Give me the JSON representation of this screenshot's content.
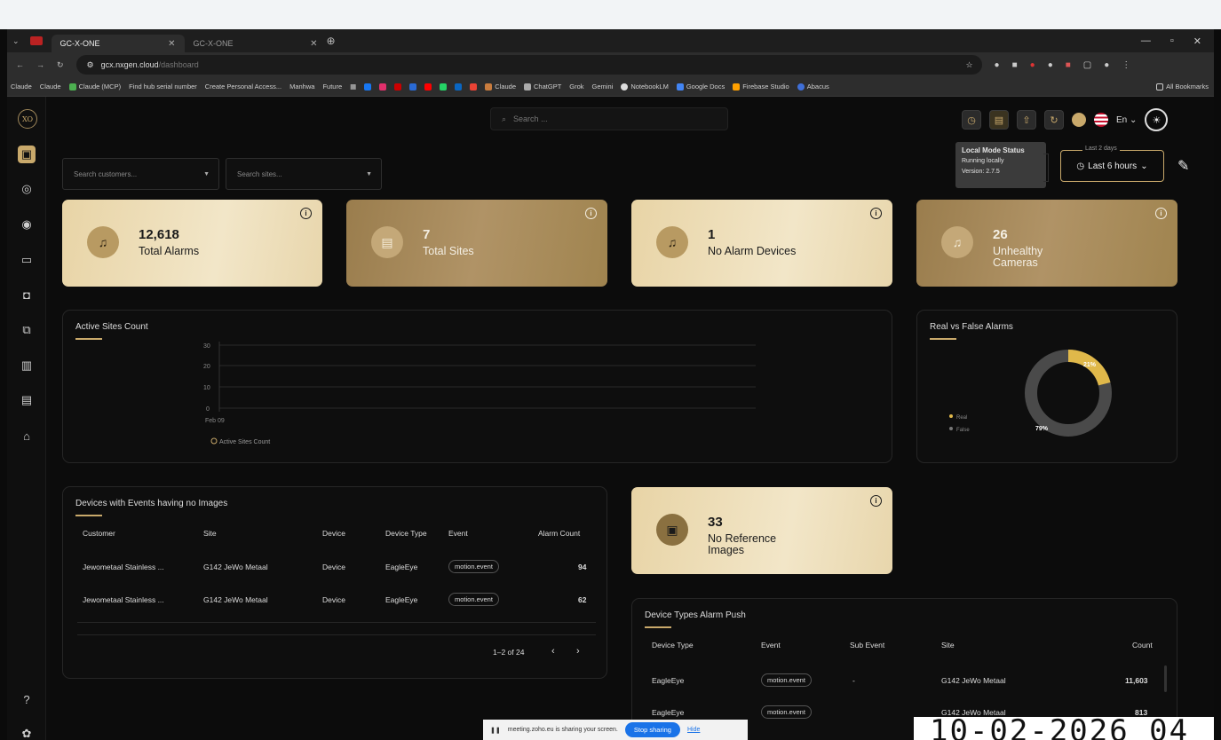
{
  "browser": {
    "tabs": [
      {
        "title": "GC-X-ONE",
        "active": true
      },
      {
        "title": "GC-X-ONE",
        "active": false
      }
    ],
    "url_host": "gcx.nxgen.cloud",
    "url_path": "/dashboard",
    "bookmarks": [
      "Claude",
      "Claude",
      "Claude (MCP)",
      "Find hub serial number",
      "Create Personal Access...",
      "Manhwa",
      "Future",
      "Claude",
      "ChatGPT",
      "Grok",
      "Gemini",
      "NotebookLM",
      "Google Docs",
      "Firebase Studio",
      "Abacus"
    ],
    "all_bookmarks": "All Bookmarks"
  },
  "header": {
    "logo_text": "XO",
    "search_placeholder": "Search ...",
    "language": "En",
    "tooltip": {
      "title": "Local Mode Status",
      "line1": "Running locally",
      "line2": "Version: 2.7.5"
    }
  },
  "filters": {
    "customers_placeholder": "Search customers...",
    "sites_placeholder": "Search sites...",
    "time_legend": "Last 2 days",
    "time_value": "Last 6 hours"
  },
  "cards": [
    {
      "value": "12,618",
      "label": "Total Alarms",
      "style": "light",
      "icon": "bell-icon"
    },
    {
      "value": "7",
      "label": "Total Sites",
      "style": "dark",
      "icon": "site-icon"
    },
    {
      "value": "1",
      "label": "No Alarm Devices",
      "style": "light",
      "icon": "bell-off-icon"
    },
    {
      "value": "26",
      "label_line1": "Unhealthy",
      "label_line2": "Cameras",
      "style": "dark",
      "icon": "camera-bell-icon"
    }
  ],
  "active_sites": {
    "title": "Active Sites Count",
    "y_ticks": [
      "30",
      "20",
      "10",
      "0"
    ],
    "x_tick": "Feb 09",
    "legend": "Active Sites Count"
  },
  "real_false": {
    "title": "Real vs False Alarms",
    "legend_real": "Real",
    "legend_false": "False",
    "label_real": "21%",
    "label_false": "79%",
    "real_pct": 21,
    "false_pct": 79,
    "color_real": "#e0b84a",
    "color_false": "#4a4a4a"
  },
  "no_images_table": {
    "title": "Devices with Events having no Images",
    "columns": [
      "Customer",
      "Site",
      "Device",
      "Device Type",
      "Event",
      "Alarm Count"
    ],
    "rows": [
      [
        "Jewometaal Stainless ...",
        "G142 JeWo Metaal",
        "Device",
        "EagleEye",
        "motion.event",
        "94"
      ],
      [
        "Jewometaal Stainless ...",
        "G142 JeWo Metaal",
        "Device",
        "EagleEye",
        "motion.event",
        "62"
      ]
    ],
    "pagination": "1–2 of 24"
  },
  "no_reference": {
    "value": "33",
    "label_line1": "No Reference",
    "label_line2": "Images"
  },
  "device_types_table": {
    "title": "Device Types Alarm Push",
    "columns": [
      "Device Type",
      "Event",
      "Sub Event",
      "Site",
      "Count"
    ],
    "rows": [
      [
        "EagleEye",
        "motion.event",
        "-",
        "G142 JeWo Metaal",
        "11,603"
      ],
      [
        "EagleEye",
        "motion.event",
        "",
        "G142 JeWo Metaal",
        "813"
      ]
    ]
  },
  "screen_share": {
    "message": "meeting.zoho.eu is sharing your screen.",
    "stop": "Stop sharing",
    "hide": "Hide"
  },
  "clock_text": "10-02-2026 04"
}
